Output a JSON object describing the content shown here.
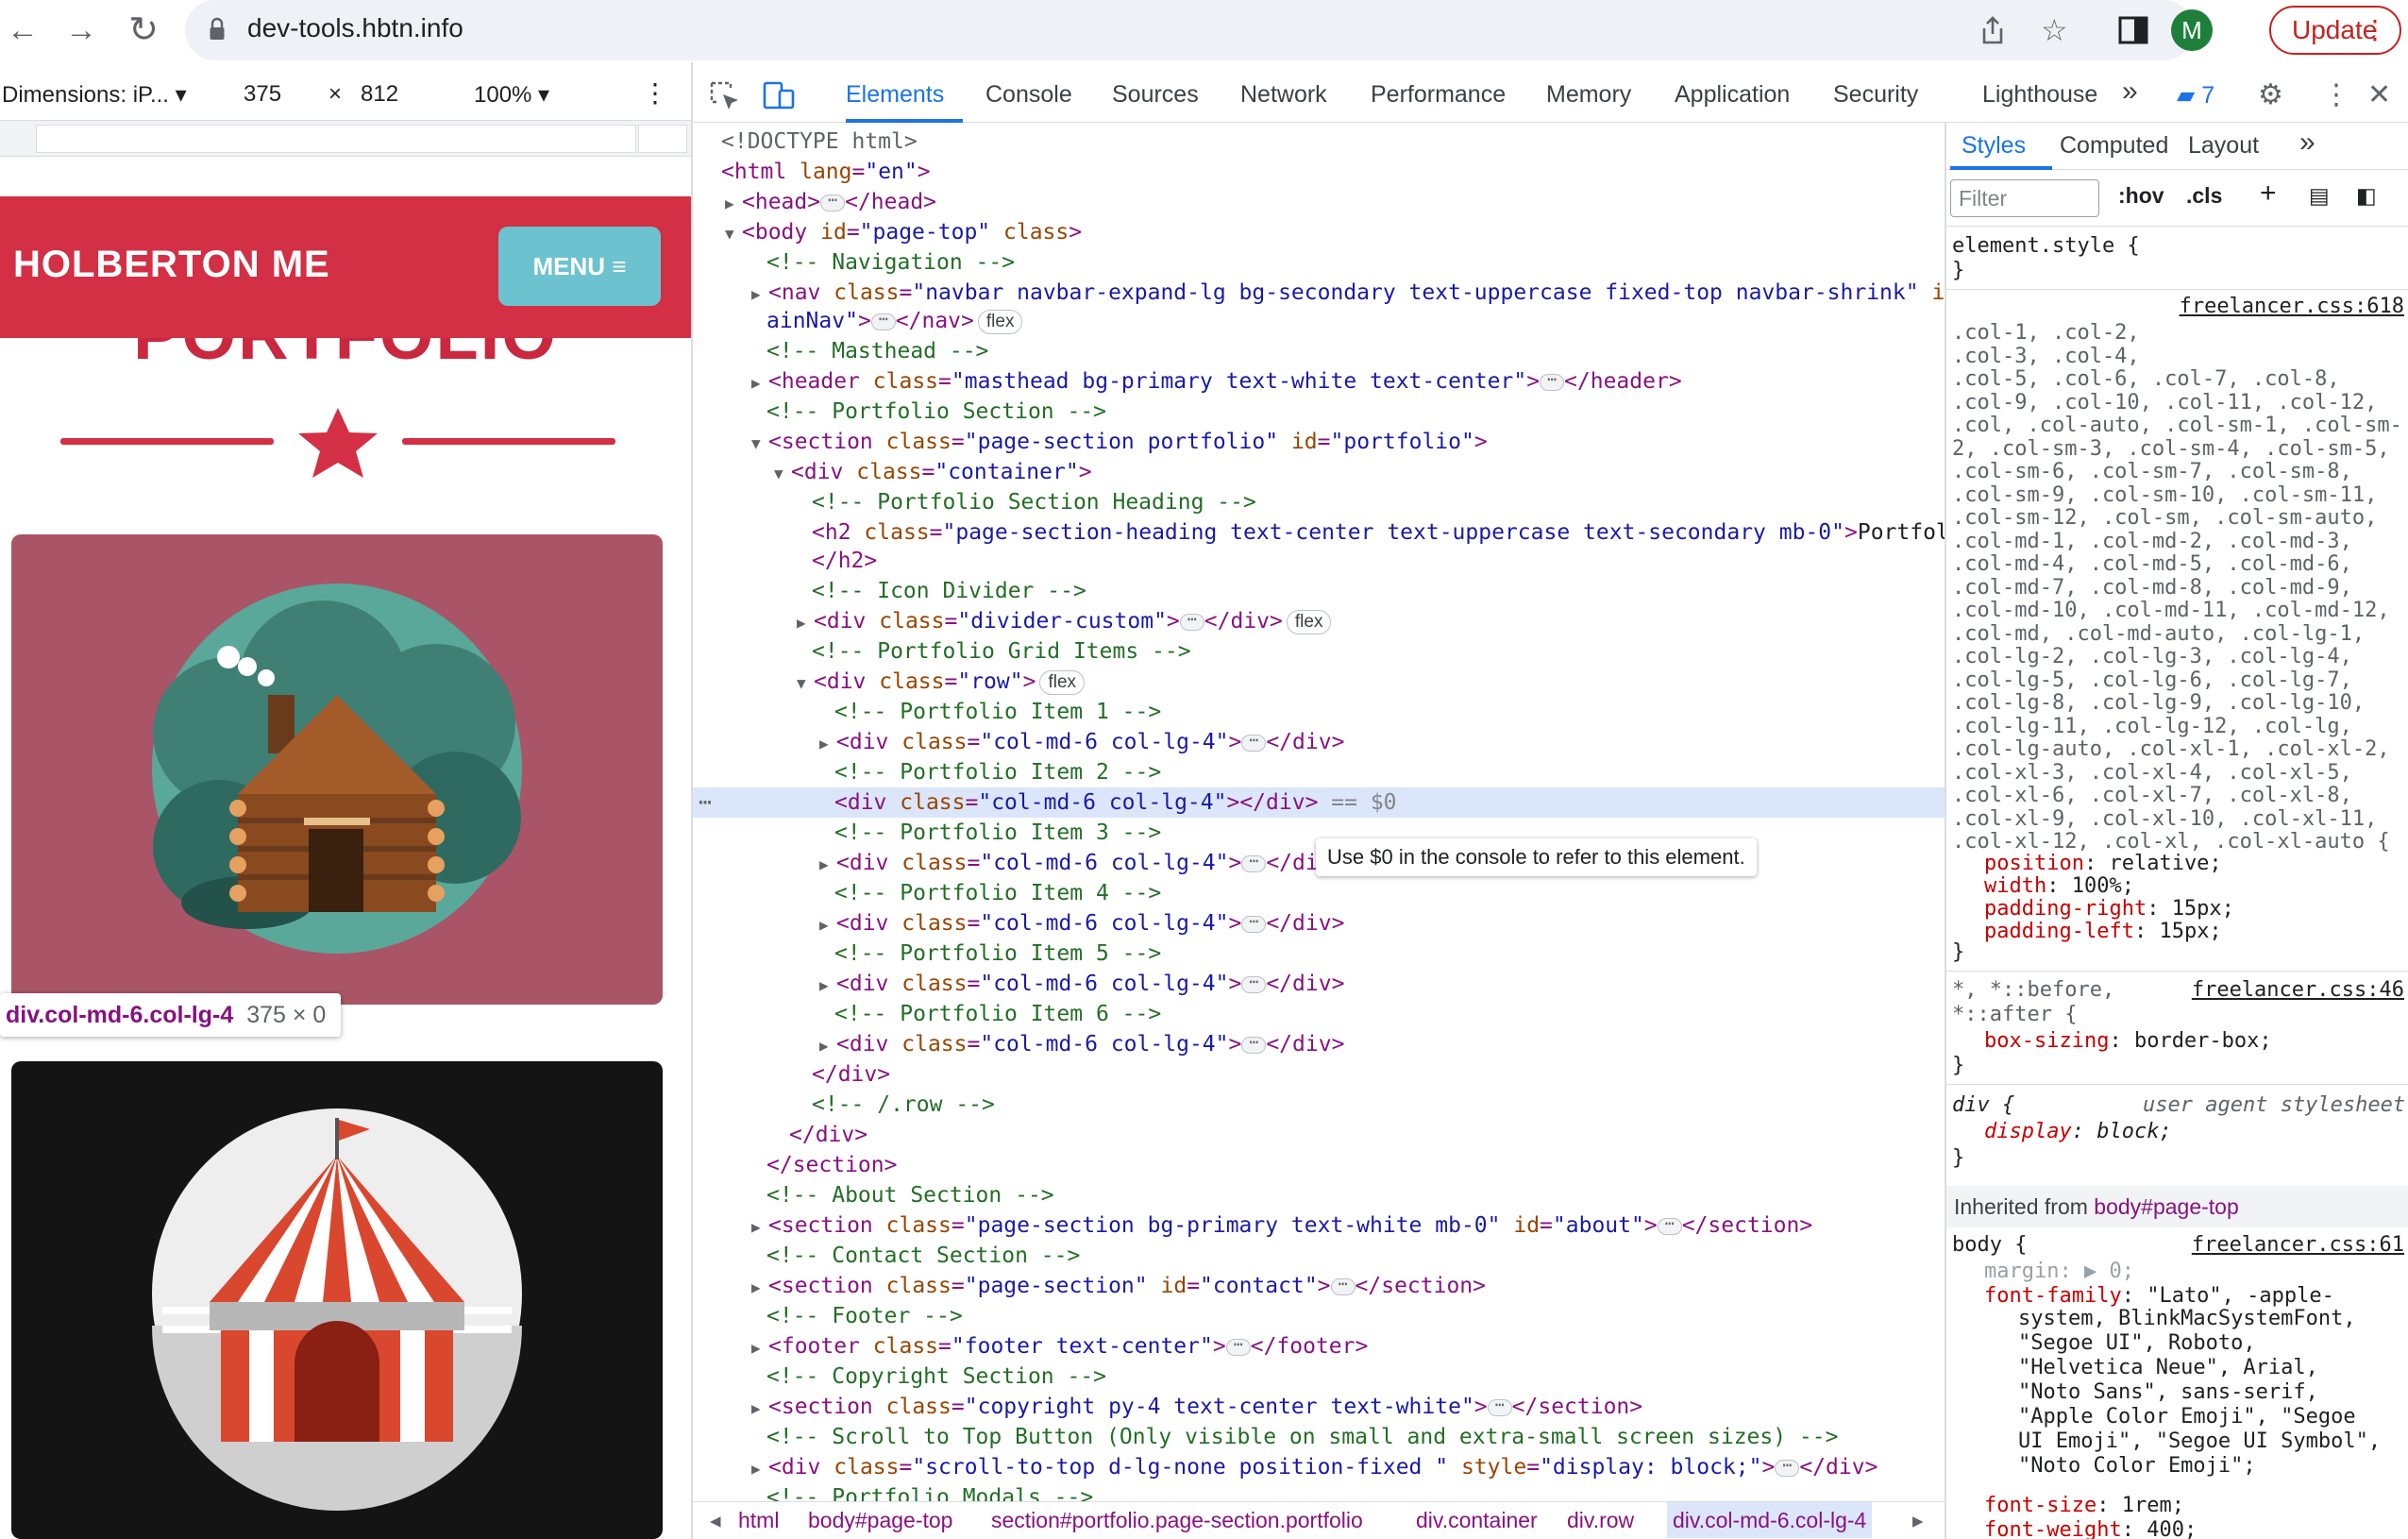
{
  "browser": {
    "url": "dev-tools.hbtn.info",
    "avatar_initial": "M",
    "update_label": "Update"
  },
  "device_toolbar": {
    "dimensions_label": "Dimensions: iP...",
    "width": "375",
    "times": "×",
    "height": "812",
    "zoom": "100%"
  },
  "site": {
    "brand": "HOLBERTON ME",
    "menu_label": "MENU ≡",
    "heading": "PORTFOLIO",
    "inspect_selector": "div.col-md-6.col-lg-4",
    "inspect_dims": "375 × 0"
  },
  "devtools": {
    "tabs": [
      "Elements",
      "Console",
      "Sources",
      "Network",
      "Performance",
      "Memory",
      "Application",
      "Security",
      "Lighthouse"
    ],
    "issues_count": "7",
    "tooltip": "Use $0 in the console to refer to this element.",
    "breadcrumbs": [
      "html",
      "body#page-top",
      "section#portfolio.page-section.portfolio",
      "div.container",
      "div.row",
      "div.col-md-6.col-lg-4"
    ]
  },
  "dom": {
    "doctype": "<!DOCTYPE html>",
    "html_open": "<html",
    "lang_attr": "lang",
    "lang_val": "\"en\"",
    "head": "<head>",
    "head_close": "</head>",
    "body_open": "<body",
    "id_attr": "id",
    "body_id": "\"page-top\"",
    "class_attr": "class",
    "nav_comment": "<!-- Navigation -->",
    "nav_open": "<nav",
    "nav_class": "\"navbar navbar-expand-lg bg-secondary text-uppercase fixed-top navbar-shrink\"",
    "nav_id_part1": "\"m",
    "nav_id_part2": "ainNav\"",
    "nav_close": "</nav>",
    "flex": "flex",
    "masthead_comment": "<!-- Masthead -->",
    "header_open": "<header",
    "header_class": "\"masthead bg-primary text-white text-center\"",
    "header_close": "</header>",
    "portfolio_comment": "<!-- Portfolio Section -->",
    "section_open": "<section",
    "section_class": "\"page-section portfolio\"",
    "section_id": "\"portfolio\"",
    "div_open": "<div",
    "container_class": "\"container\"",
    "heading_comment": "<!-- Portfolio Section Heading -->",
    "h2_open": "<h2",
    "h2_class": "\"page-section-heading text-center text-uppercase text-secondary mb-0\"",
    "h2_text": "Portfolio",
    "h2_close": "</h2>",
    "icon_comment": "<!-- Icon Divider -->",
    "divider_class": "\"divider-custom\"",
    "div_close": "</div>",
    "grid_comment": "<!-- Portfolio Grid Items -->",
    "row_class": "\"row\"",
    "item1_comment": "<!-- Portfolio Item 1 -->",
    "col_class": "\"col-md-6 col-lg-4\"",
    "item2_comment": "<!-- Portfolio Item 2 -->",
    "eq_dollar": "== $0",
    "item3_comment": "<!-- Portfolio Item 3 -->",
    "item3_close_cut": "</div",
    "item4_comment": "<!-- Portfolio Item 4 -->",
    "item5_comment": "<!-- Portfolio Item 5 -->",
    "item6_comment": "<!-- Portfolio Item 6 -->",
    "row_end_comment": "<!-- /.row -->",
    "section_close": "</section>",
    "about_comment": "<!-- About Section -->",
    "about_class": "\"page-section bg-primary text-white mb-0\"",
    "about_id": "\"about\"",
    "contact_comment": "<!-- Contact Section -->",
    "contact_class": "\"page-section\"",
    "contact_id": "\"contact\"",
    "footer_comment": "<!-- Footer -->",
    "footer_open": "<footer",
    "footer_class": "\"footer text-center\"",
    "footer_close": "</footer>",
    "copyright_comment": "<!-- Copyright Section -->",
    "copyright_class": "\"copyright py-4 text-center text-white\"",
    "scroll_comment": "<!-- Scroll to Top Button (Only visible on small and extra-small screen sizes) -->",
    "scroll_class": "\"scroll-to-top d-lg-none position-fixed \"",
    "style_attr": "style",
    "scroll_style": "\"display: block;\"",
    "modals_comment": "<!-- Portfolio Modals -->"
  },
  "styles": {
    "tabs": [
      "Styles",
      "Computed",
      "Layout"
    ],
    "filter_placeholder": "Filter",
    "hov": ":hov",
    "cls": ".cls",
    "element_style": "element.style {",
    "close_brace": "}",
    "col_rule_source": "freelancer.css:618",
    "col_selectors": [
      ".col-1, .col-2,",
      ".col-3, .col-4,",
      ".col-5, .col-6, .col-7, .col-8,",
      ".col-9, .col-10, .col-11, .col-12,",
      ".col, .col-auto, .col-sm-1, .col-sm-",
      "2, .col-sm-3, .col-sm-4, .col-sm-5,",
      ".col-sm-6, .col-sm-7, .col-sm-8,",
      ".col-sm-9, .col-sm-10, .col-sm-11,",
      ".col-sm-12, .col-sm, .col-sm-auto,",
      ".col-md-1, .col-md-2, .col-md-3,",
      ".col-md-4, .col-md-5, .col-md-6,",
      ".col-md-7, .col-md-8, .col-md-9,",
      ".col-md-10, .col-md-11, .col-md-12,",
      ".col-md, .col-md-auto, .col-lg-1,",
      ".col-lg-2, .col-lg-3, .col-lg-4,",
      ".col-lg-5, .col-lg-6, .col-lg-7,",
      ".col-lg-8, .col-lg-9, .col-lg-10,",
      ".col-lg-11, .col-lg-12, .col-lg,",
      ".col-lg-auto, .col-xl-1, .col-xl-2,",
      ".col-xl-3, .col-xl-4, .col-xl-5,",
      ".col-xl-6, .col-xl-7, .col-xl-8,",
      ".col-xl-9, .col-xl-10, .col-xl-11,",
      ".col-xl-12, .col-xl, .col-xl-auto {"
    ],
    "col_props": [
      {
        "p": "position",
        "v": "relative;"
      },
      {
        "p": "width",
        "v": "100%;"
      },
      {
        "p": "padding-right",
        "v": "15px;"
      },
      {
        "p": "padding-left",
        "v": "15px;"
      }
    ],
    "star_selector_1": "*, *::before,",
    "star_selector_2": "*::after {",
    "star_source": "freelancer.css:46",
    "box_sizing_p": "box-sizing",
    "box_sizing_v": "border-box;",
    "div_selector": "div {",
    "ua_label": "user agent stylesheet",
    "display_p": "display",
    "display_v": "block;",
    "inherited_from": "Inherited from",
    "inherited_el": "body#page-top",
    "body_selector": "body {",
    "body_source": "freelancer.css:61",
    "margin_p": "margin",
    "margin_v": "▶ 0;",
    "font_family_p": "font-family",
    "font_family_lines": [
      "\"Lato\", -apple-",
      "system, BlinkMacSystemFont,",
      "\"Segoe UI\", Roboto,",
      "\"Helvetica Neue\", Arial,",
      "\"Noto Sans\", sans-serif,",
      "\"Apple Color Emoji\", \"Segoe",
      "UI Emoji\", \"Segoe UI Symbol\",",
      "\"Noto Color Emoji\";"
    ],
    "font_size_p": "font-size",
    "font_size_v": "1rem;",
    "font_weight_p": "font-weight",
    "font_weight_v": "400;"
  },
  "colors": {
    "site_primary": "#d32f45",
    "site_accent": "#6cc3cf",
    "devtools_accent": "#1a73e8",
    "selected_row": "#dbe6fb"
  }
}
